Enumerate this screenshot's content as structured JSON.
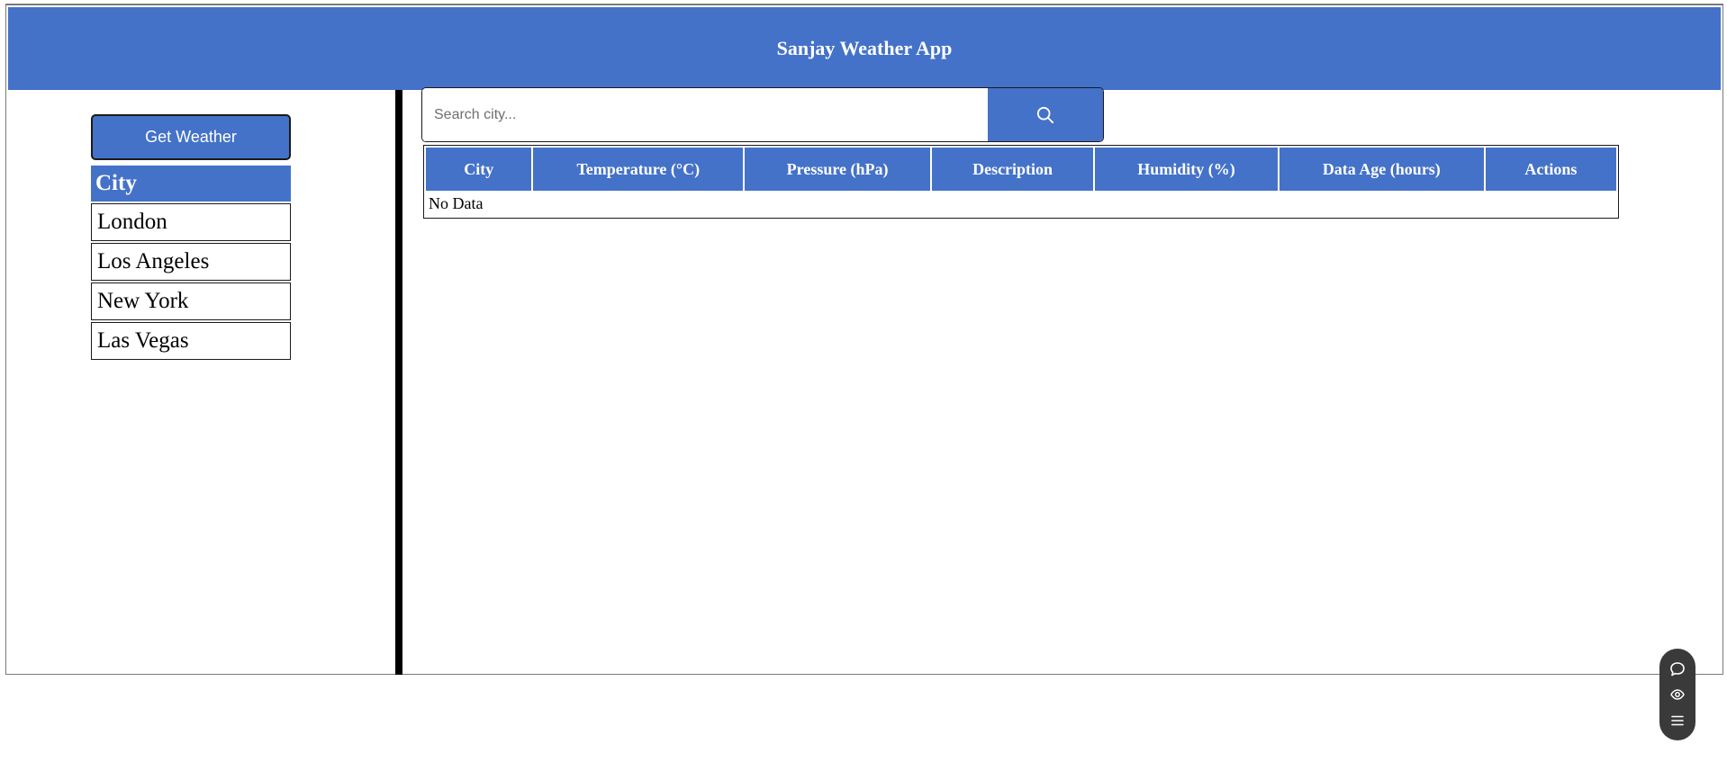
{
  "header": {
    "title": "Sanjay Weather App"
  },
  "sidebar": {
    "get_weather_label": "Get Weather",
    "city_header": "City",
    "cities": [
      "London",
      "Los Angeles",
      "New York",
      "Las Vegas"
    ]
  },
  "search": {
    "placeholder": "Search city...",
    "button_icon": "search-icon"
  },
  "table": {
    "columns": [
      "City",
      "Temperature (°C)",
      "Pressure (hPa)",
      "Description",
      "Humidity (%)",
      "Data Age (hours)",
      "Actions"
    ],
    "empty_text": "No Data"
  },
  "toolbar": {
    "icons": [
      "chat-icon",
      "eye-icon",
      "menu-icon"
    ]
  },
  "colors": {
    "accent": "#4472c8",
    "toolbar": "#3a3a3a"
  }
}
